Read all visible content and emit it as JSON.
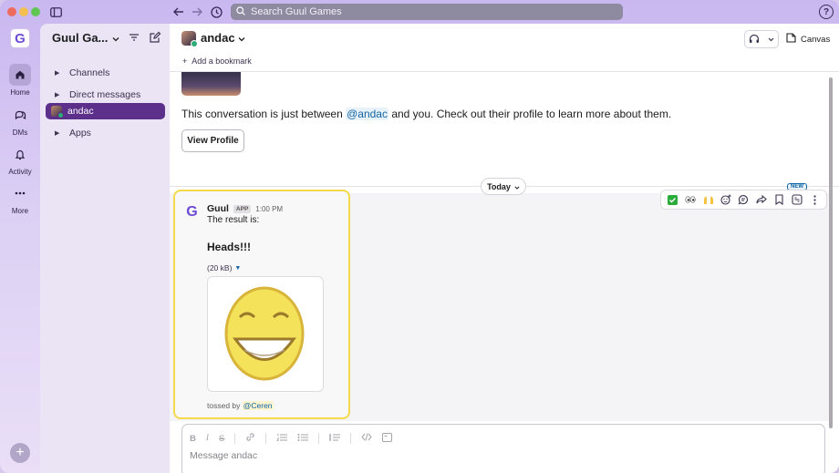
{
  "titlebar": {
    "search_placeholder": "Search Guul Games",
    "help_glyph": "?"
  },
  "rail": {
    "workspace_initial": "G",
    "items": [
      {
        "label": "Home",
        "icon": "home-icon"
      },
      {
        "label": "DMs",
        "icon": "dms-icon"
      },
      {
        "label": "Activity",
        "icon": "bell-icon"
      },
      {
        "label": "More",
        "icon": "more-icon"
      }
    ],
    "add_glyph": "+"
  },
  "sidebar": {
    "workspace_name": "Guul Ga...",
    "sections": [
      {
        "label": "Channels"
      },
      {
        "label": "Direct messages"
      }
    ],
    "selected_dm": "andac",
    "apps_label": "Apps"
  },
  "header": {
    "channel_name": "andac",
    "canvas_label": "Canvas",
    "bookmark_label": "Add a bookmark"
  },
  "intro": {
    "text_before": "This conversation is just between ",
    "mention": "@andac",
    "text_after": " and you. Check out their profile to learn more about them.",
    "view_profile_label": "View Profile"
  },
  "day_divider": {
    "label": "Today"
  },
  "message": {
    "bot_initial": "G",
    "sender": "Guul",
    "badge": "APP",
    "time": "1:00 PM",
    "line1": "The result is:",
    "result": "Heads!!!",
    "file_size": "(20 kB)",
    "tossed_by_prefix": "tossed by ",
    "tossed_by_user": "@Ceren"
  },
  "actions": {
    "new_badge": "NEW",
    "items": [
      "check-reaction-icon",
      "eyes-reaction-icon",
      "raised-hands-reaction-icon",
      "add-reaction-icon",
      "reply-thread-icon",
      "forward-icon",
      "bookmark-icon",
      "workflow-icon",
      "more-actions-icon"
    ]
  },
  "composer": {
    "placeholder": "Message andac"
  },
  "colors": {
    "sidebar_selected": "#5b2f8a",
    "highlight_border": "#f5d94a",
    "mention": "#1264a3",
    "brand": "#6c4bd6"
  }
}
